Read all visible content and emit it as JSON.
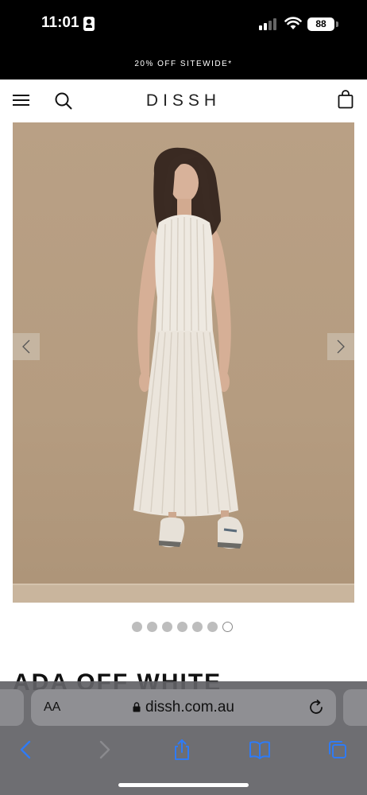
{
  "status": {
    "time": "11:01",
    "battery": "88"
  },
  "promo": {
    "text": "20% OFF SITEWIDE*"
  },
  "header": {
    "logo": "DISSH"
  },
  "carousel": {
    "dot_count": 7,
    "active_index": 6
  },
  "product": {
    "title": "ADA OFF WHITE"
  },
  "browser": {
    "text_size_label": "AA",
    "url": "dissh.com.au"
  },
  "colors": {
    "accent": "#2f7bf5",
    "background_photo": "#b59c80"
  }
}
